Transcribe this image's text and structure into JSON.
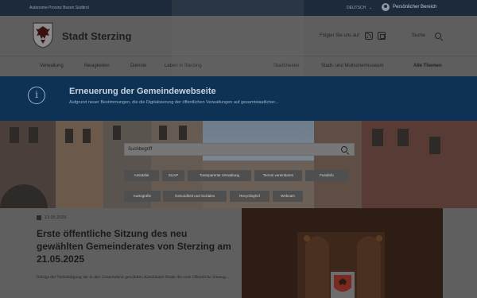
{
  "topbar": {
    "region": "Autonome Provinz Bozen Südtirol",
    "language": "DEUTSCH",
    "personal": "Persönlicher Bereich"
  },
  "header": {
    "title": "Stadt Sterzing",
    "follow": "Folgen Sie uns auf",
    "search": "Suche"
  },
  "nav": {
    "items": [
      "Verwaltung",
      "Neuigkeiten",
      "Dienste",
      "Leben in Sterzing",
      "Stadttheater",
      "Stadt- und Multschermuseum",
      "Alle Themen"
    ]
  },
  "banner": {
    "title": "Erneuerung der Gemeindewebseite",
    "text": "Aufgrund neuer Bestimmungen, die die Digitalisierung der öffentlichen Verwaltungen auf gesamtstaatlicher..."
  },
  "hero": {
    "search_placeholder": "Suchbegriff",
    "chips_row1": [
      "Amtstafel",
      "SUAP",
      "Transparente Verwaltung",
      "Termin vereinbaren",
      "Fundinfo"
    ],
    "chips_row2": [
      "Kartografie",
      "Gesundheit und Soziales",
      "Recyclinghof",
      "Webcam"
    ]
  },
  "news": {
    "date": "13.05.2025",
    "title": "Erste öffentliche Sitzung des neu gewählten Gemeinderates von Sterzing am 21.05.2025",
    "excerpt": "Infolge der Verkündigung der in den Gemeinderat gewählten Kandidaten findet die erste öffentliche Sitzung..."
  },
  "colors": {
    "banner": "#0d3256",
    "topbar": "#1c2a3b"
  }
}
